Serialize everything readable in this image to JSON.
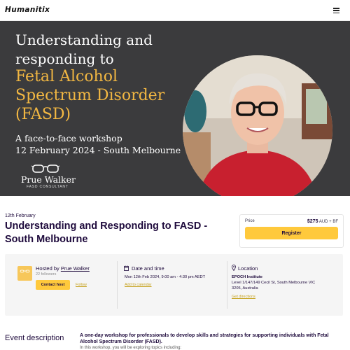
{
  "header": {
    "logo": "Humanitix",
    "menu_icon": "hamburger-menu-icon"
  },
  "banner": {
    "title_line1": "Understanding and",
    "title_line2": "responding to",
    "highlight_line1": "Fetal Alcohol",
    "highlight_line2": "Spectrum Disorder",
    "highlight_line3": "(FASD)",
    "subtitle_line1": "A face-to-face workshop",
    "subtitle_line2": "12 February 2024 - South Melbourne",
    "presenter_name": "Prue Walker",
    "presenter_role": "FASD CONSULTANT",
    "colors": {
      "background": "#3b3b3d",
      "highlight": "#f2b742"
    }
  },
  "event": {
    "date_short": "12th February",
    "title": "Understanding and Responding to FASD - South Melbourne"
  },
  "pricing": {
    "label": "Price",
    "amount": "$275",
    "suffix": "AUD + BF",
    "register_label": "Register",
    "accent": "#ffc93c"
  },
  "host": {
    "prefix": "Hosted by ",
    "name": "Prue Walker",
    "followers": "22 followers",
    "contact_label": "Contact host",
    "follow_label": "Follow"
  },
  "datetime": {
    "heading": "Date and time",
    "icon": "calendar-icon",
    "value": "Mon 12th Feb 2024, 9:00 am - 4:30 pm AEDT",
    "add_label": "Add to calendar"
  },
  "location": {
    "heading": "Location",
    "icon": "location-pin-icon",
    "venue": "EPOCH Institute",
    "address_line1": "Level 1/147/149 Cecil St, South Melbourne VIC",
    "address_line2": "3205, Australia",
    "directions_label": "Get directions"
  },
  "description": {
    "heading": "Event description",
    "summary": "A one-day workshop for professionals to develop skills and strategies for supporting individuals with Fetal Alcohol Spectrum Disorder (FASD).",
    "more": "In this workshop, you will be exploring topics including:"
  }
}
